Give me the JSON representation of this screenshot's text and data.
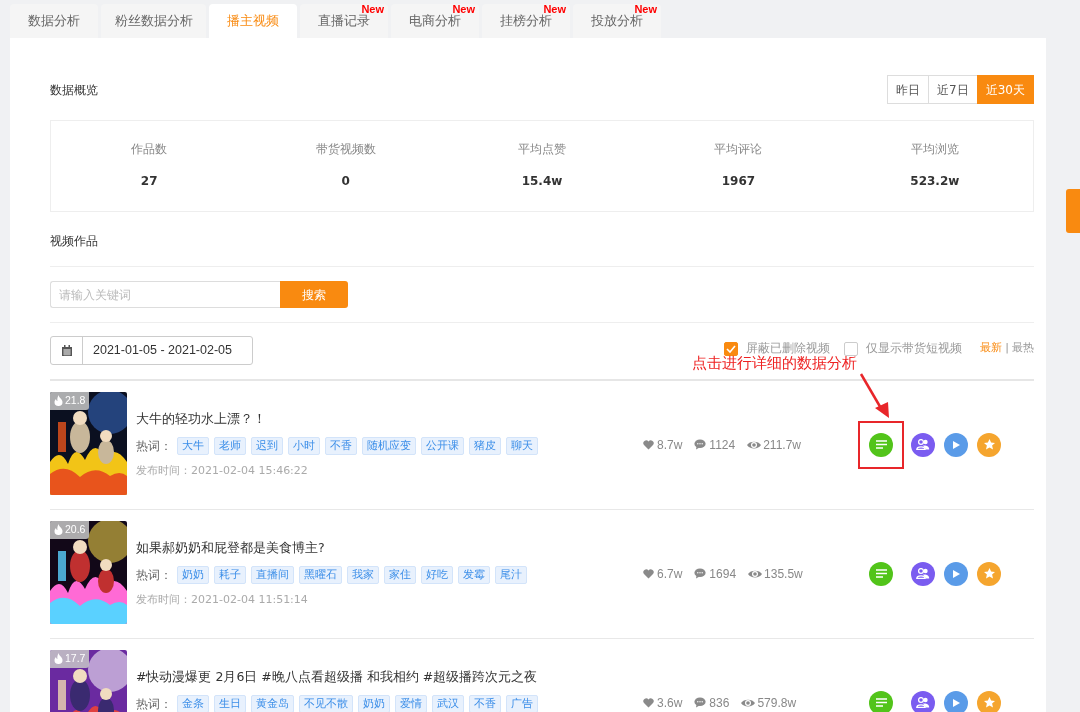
{
  "tabs": [
    {
      "label": "数据分析",
      "selected": false
    },
    {
      "label": "粉丝数据分析",
      "selected": false
    },
    {
      "label": "播主视频",
      "selected": true
    },
    {
      "label": "直播记录",
      "selected": false,
      "badge": "New"
    },
    {
      "label": "电商分析",
      "selected": false,
      "badge": "New"
    },
    {
      "label": "挂榜分析",
      "selected": false,
      "badge": "New"
    },
    {
      "label": "投放分析",
      "selected": false,
      "badge": "New"
    }
  ],
  "overview": {
    "title": "数据概览",
    "ranges": [
      {
        "label": "昨日",
        "selected": false
      },
      {
        "label": "近7日",
        "selected": false
      },
      {
        "label": "近30天",
        "selected": true
      }
    ],
    "stats": [
      {
        "label": "作品数",
        "value": "27"
      },
      {
        "label": "带货视频数",
        "value": "0"
      },
      {
        "label": "平均点赞",
        "value": "15.4w"
      },
      {
        "label": "平均评论",
        "value": "1967"
      },
      {
        "label": "平均浏览",
        "value": "523.2w"
      }
    ]
  },
  "videos_section": {
    "title": "视频作品",
    "search": {
      "placeholder": "请输入关键词",
      "button": "搜索"
    },
    "date_range": "2021-01-05 - 2021-02-05",
    "filters": [
      {
        "label": "屏蔽已删除视频",
        "checked": true
      },
      {
        "label": "仅显示带货短视频",
        "checked": false
      }
    ],
    "sort": [
      {
        "label": "最新",
        "selected": true
      },
      {
        "label": "最热",
        "selected": false
      }
    ],
    "sort_separator": "|"
  },
  "videos": [
    {
      "heat": "21.8",
      "title": "大牛的轻功水上漂？！",
      "hotwords_label": "热词：",
      "tags": [
        "大牛",
        "老师",
        "迟到",
        "小时",
        "不香",
        "随机应变",
        "公开课",
        "猪皮",
        "聊天"
      ],
      "published": "发布时间：2021-02-04 15:46:22",
      "likes": "8.7w",
      "comments": "1124",
      "views": "211.7w",
      "highlighted": true
    },
    {
      "heat": "20.6",
      "title": "如果郝奶奶和屁登都是美食博主?",
      "hotwords_label": "热词：",
      "tags": [
        "奶奶",
        "耗子",
        "直播间",
        "黑曜石",
        "我家",
        "家住",
        "好吃",
        "发霉",
        "尾汁"
      ],
      "published": "发布时间：2021-02-04 11:51:14",
      "likes": "6.7w",
      "comments": "1694",
      "views": "135.5w",
      "highlighted": false
    },
    {
      "heat": "17.7",
      "title": "#快动漫爆更 2月6日 #晚八点看超级播 和我相约 #超级播跨次元之夜",
      "hotwords_label": "热词：",
      "tags": [
        "金条",
        "生日",
        "黄金岛",
        "不见不散",
        "奶奶",
        "爱情",
        "武汉",
        "不香",
        "广告"
      ],
      "likes": "3.6w",
      "comments": "836",
      "views": "579.8w",
      "highlighted": false
    }
  ],
  "annotation": {
    "text": "点击进行详细的数据分析"
  }
}
